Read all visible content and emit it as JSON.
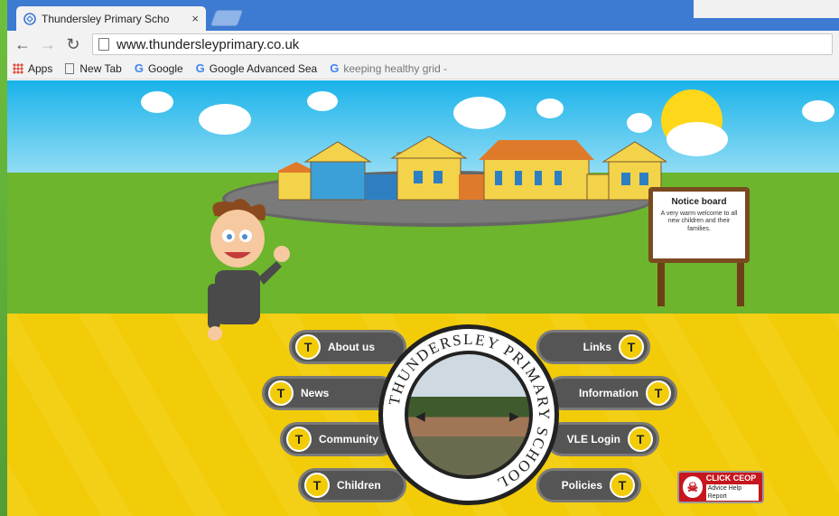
{
  "browser": {
    "tab_title": "Thundersley Primary Scho",
    "tab_close": "×",
    "url": "www.thundersleyprimary.co.uk",
    "back_icon": "arrow-left-icon",
    "forward_icon": "arrow-right-icon",
    "reload_icon": "reload-icon"
  },
  "bookmarks": [
    {
      "label": "Apps",
      "icon": "apps-grid-icon"
    },
    {
      "label": "New Tab",
      "icon": "page-icon"
    },
    {
      "label": "Google",
      "icon": "google-icon",
      "glyph": "G"
    },
    {
      "label": "Google Advanced Sea",
      "icon": "google-icon",
      "glyph": "G"
    },
    {
      "label": "keeping healthy grid -",
      "icon": "google-icon",
      "glyph": "G"
    }
  ],
  "notice_board": {
    "title": "Notice board",
    "text": "A very warm welcome to all new children and their families."
  },
  "emblem": {
    "ring_text": "THUNDERSLEY PRIMARY SCHOOL",
    "prev_icon": "chevron-left-icon",
    "next_icon": "chevron-right-icon"
  },
  "nav": {
    "badge_glyph": "T",
    "about": "About us",
    "news": "News",
    "community": "Community",
    "children": "Children",
    "links": "Links",
    "information": "Information",
    "vle": "VLE Login",
    "policies": "Policies"
  },
  "ceop": {
    "main": "CLICK CEOP",
    "sub": "Advice Help Report"
  },
  "colors": {
    "tabstrip": "#3d7ad1",
    "sky": "#1ab3ea",
    "grass": "#6cb52d",
    "yellow": "#f2cc08",
    "pill": "#555555"
  }
}
